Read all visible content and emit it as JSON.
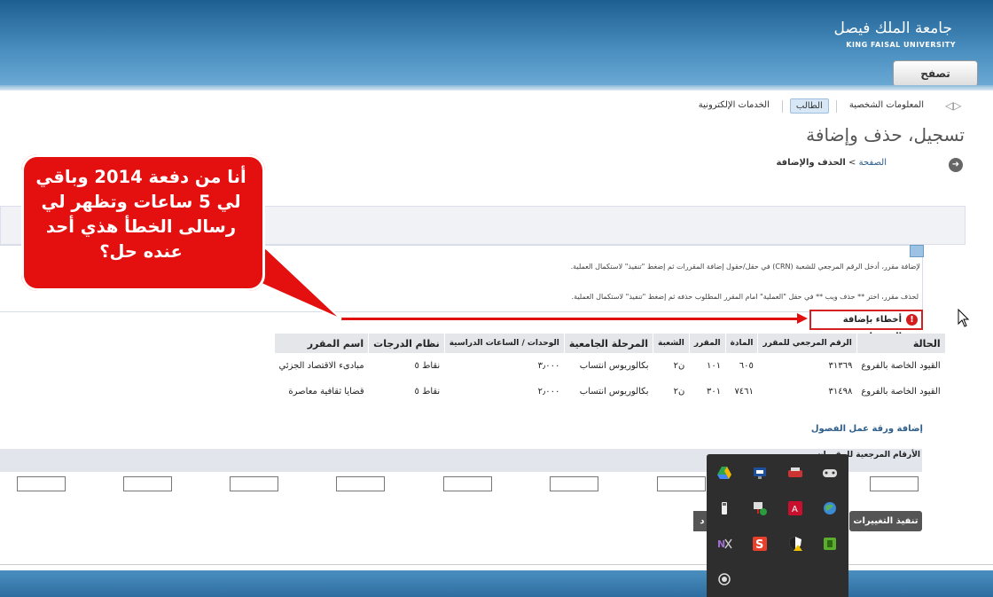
{
  "header": {
    "university_ar": "جامعة الملك فيصل",
    "university_en": "KING FAISAL UNIVERSITY",
    "browse_button": "تصفح"
  },
  "nav": {
    "tabs": [
      {
        "label": "المعلومات الشخصية"
      },
      {
        "label": "الطالب",
        "active": true
      },
      {
        "label": "الخدمات الإلكترونية"
      }
    ]
  },
  "page": {
    "title": "تسجيل، حذف وإضافة",
    "breadcrumb_home": "الصفحة",
    "breadcrumb_sep": ">",
    "breadcrumb_current": "الحذف والإضافة"
  },
  "info": {
    "line1": "لإضافة مقرر، أدخل الرقم المرجعي للشعبة (CRN) في حقل/حقول إضافة المقررات ثم إضغط \"تنفيذ\" لاستكمال العملية.",
    "line2": "لحذف مقرر، اختر ** حذف ويب ** في حقل \"العملية\" امام المقرر المطلوب حذفه ثم إضغط \"تنفيذ\" لاستكمال العملية."
  },
  "errors": {
    "title": "أخطاء بإضافة التسجيل",
    "columns": [
      "الحالة",
      "الرقم المرجعي للمقرر",
      "المادة",
      "المقرر",
      "الشعبة",
      "المرحلة الجامعية",
      "الوحدات / الساعات الدراسية",
      "نظام الدرجات",
      "اسم المقرر"
    ],
    "rows": [
      [
        "القيود الخاصة بالفروع",
        "٣١٣٦٩",
        "٦٠٥",
        "١٠١",
        "ن٢",
        "بكالوريوس انتساب",
        "٣٫٠٠٠",
        "نقاط ٥",
        "مبادىء الاقتصاد الجزئي"
      ],
      [
        "القيود الخاصة بالفروع",
        "٣١٤٩٨",
        "٧٤٦١",
        "٣٠١",
        "ن٢",
        "بكالوريوس انتساب",
        "٢٫٠٠٠",
        "نقاط ٥",
        "قضايا ثقافية معاصرة"
      ]
    ]
  },
  "worksheet": {
    "title": "إضافة ورقة عمل الفصول",
    "label": "الأرقام المرجعية للمقررات",
    "submit": "تنفيذ التغييرات",
    "reset": "د"
  },
  "callout": {
    "text": "أنا من دفعة 2014 وباقي لي 5 ساعات وتظهر لي رسالى الخطأ هذي أحد عنده حل؟"
  },
  "tray_icons": [
    "gamepad-icon",
    "remote-icon",
    "monitor-icon",
    "drive-icon",
    "globe-icon",
    "acrobat-icon",
    "network-icon",
    "usb-icon",
    "clip-icon",
    "shield-warning-icon",
    "s-app-icon",
    "onenote-icon",
    "record-icon"
  ],
  "colors": {
    "header": "#2e6d9f",
    "error": "#d41c1c",
    "callout": "#e40f0f"
  }
}
